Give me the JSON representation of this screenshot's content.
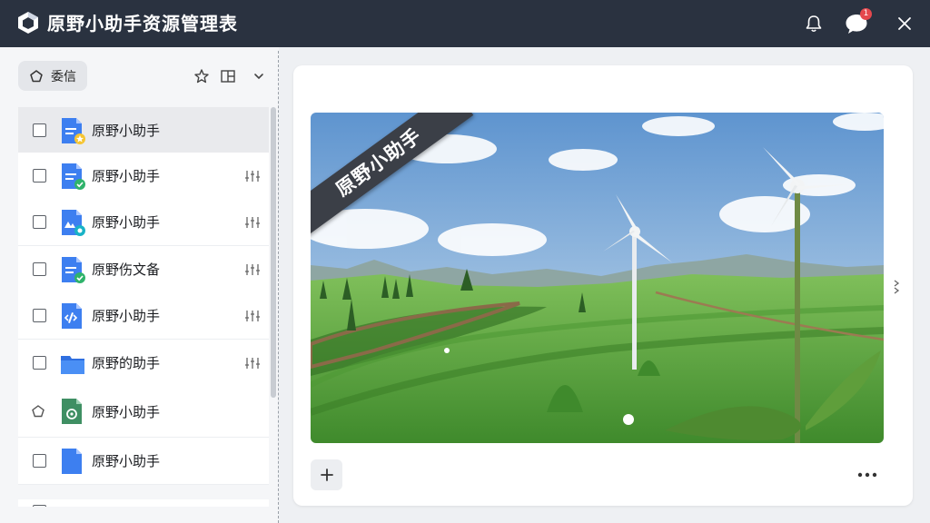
{
  "app": {
    "title": "原野小助手资源管理表",
    "notification_count": "1"
  },
  "sidebar": {
    "chip_label": "委信",
    "tools": [
      "star-icon",
      "layout-icon",
      "chevron-down-icon"
    ],
    "items": [
      {
        "label": "原野小助手",
        "icon": "doc-star-icon",
        "selected": true,
        "tool": ""
      },
      {
        "label": "原野小助手",
        "icon": "doc-check-icon",
        "selected": false,
        "tool": "sliders-icon"
      },
      {
        "label": "原野小助手",
        "icon": "doc-image-icon",
        "selected": false,
        "tool": "sliders-icon"
      },
      {
        "label": "原野伤文备",
        "icon": "doc-check-icon",
        "selected": false,
        "tool": "sliders-icon"
      },
      {
        "label": "原野小助手",
        "icon": "doc-code-icon",
        "selected": false,
        "tool": "sliders-icon"
      },
      {
        "label": "原野的助手",
        "icon": "folder-icon",
        "selected": false,
        "tool": "sliders-icon"
      },
      {
        "label": "原野小助手",
        "icon": "green-doc-icon",
        "selected": false,
        "tool": ""
      },
      {
        "label": "原野小助手",
        "icon": "blue-doc-icon",
        "selected": false,
        "tool": ""
      }
    ]
  },
  "preview": {
    "ribbon_text": "原野小助手"
  },
  "colors": {
    "titlebar": "#2a3240",
    "accent_blue": "#3d7ff0",
    "badge": "#e5484d",
    "green": "#2fb36b"
  }
}
